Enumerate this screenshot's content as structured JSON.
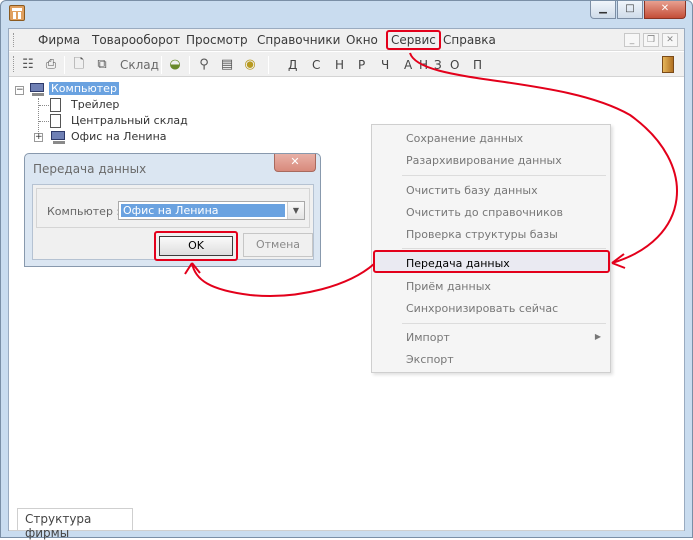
{
  "menubar": {
    "items": [
      "Фирма",
      "Товарооборот",
      "Просмотр",
      "Справочники",
      "Окно",
      "Сервис",
      "Справка"
    ]
  },
  "toolbar": {
    "sklad_label": "Склад",
    "letters": [
      "Д",
      "С",
      "Н",
      "Р",
      "Ч",
      "А",
      "Н",
      "З",
      "О",
      "П"
    ]
  },
  "tree": {
    "root": "Компьютер",
    "children": [
      "Трейлер",
      "Центральный склад",
      "Офис на Ленина"
    ]
  },
  "bottom_tab": "Структура фирмы",
  "dialog": {
    "title": "Передача данных",
    "close": "✕",
    "computer_label": "Компьютер :",
    "computer_value": "Офис на Ленина",
    "ok": "OK",
    "cancel": "Отмена"
  },
  "service_menu": {
    "items": [
      "Сохранение данных",
      "Разархивирование данных",
      "Очистить базу данных",
      "Очистить до справочников",
      "Проверка структуры базы",
      "Передача данных",
      "Приём данных",
      "Синхронизировать сейчас",
      "Импорт",
      "Экспорт"
    ]
  },
  "colors": {
    "annotation": "#e3001b",
    "selection": "#6aa2e0"
  }
}
